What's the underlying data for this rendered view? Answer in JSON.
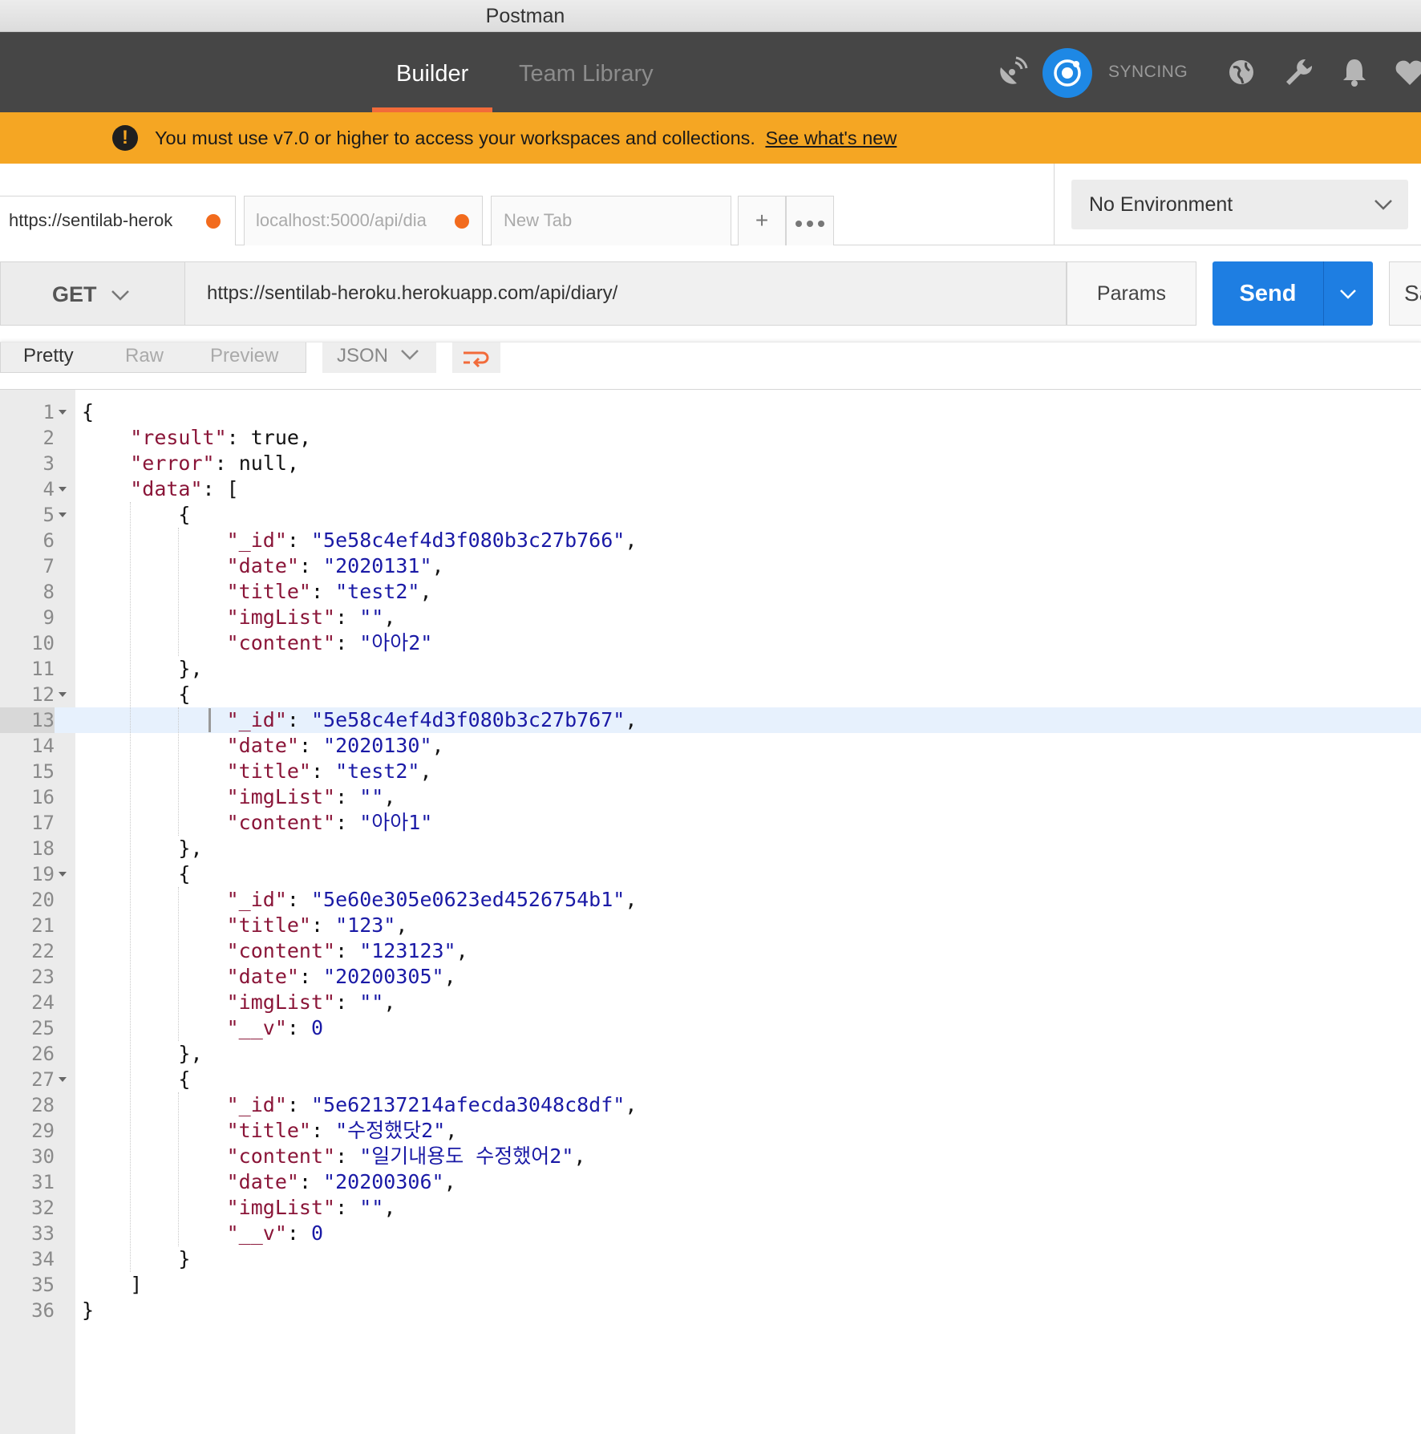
{
  "window": {
    "title": "Postman"
  },
  "nav": {
    "tabs": [
      {
        "label": "Builder"
      },
      {
        "label": "Team Library"
      }
    ],
    "sync_label": "SYNCING",
    "icons": [
      "satellite-icon",
      "sync-icon",
      "globe-icon",
      "wrench-icon",
      "bell-icon",
      "heart-icon"
    ]
  },
  "banner": {
    "message": "You must use v7.0 or higher to access your workspaces and collections.",
    "link": "See what's new",
    "color": "#f5a623"
  },
  "tabs": [
    {
      "label": "https://sentilab-herok",
      "unsaved": true
    },
    {
      "label": "localhost:5000/api/dia",
      "unsaved": true
    },
    {
      "label": "New Tab",
      "unsaved": false
    }
  ],
  "environment": {
    "selected": "No Environment"
  },
  "request": {
    "method": "GET",
    "url": "https://sentilab-heroku.herokuapp.com/api/diary/",
    "params_label": "Params",
    "send_label": "Send",
    "save_label": "Sa",
    "accent": "#1e7ee2"
  },
  "response": {
    "view_tabs": [
      "Pretty",
      "Raw",
      "Preview"
    ],
    "active_view": "Pretty",
    "format": "JSON",
    "highlighted_line": 13,
    "lines": [
      "{",
      "    \"result\": true,",
      "    \"error\": null,",
      "    \"data\": [",
      "        {",
      "            \"_id\": \"5e58c4ef4d3f080b3c27b766\",",
      "            \"date\": \"2020131\",",
      "            \"title\": \"test2\",",
      "            \"imgList\": \"\",",
      "            \"content\": \"아아2\"",
      "        },",
      "        {",
      "            \"_id\": \"5e58c4ef4d3f080b3c27b767\",",
      "            \"date\": \"2020130\",",
      "            \"title\": \"test2\",",
      "            \"imgList\": \"\",",
      "            \"content\": \"아아1\"",
      "        },",
      "        {",
      "            \"_id\": \"5e60e305e0623ed4526754b1\",",
      "            \"title\": \"123\",",
      "            \"content\": \"123123\",",
      "            \"date\": \"20200305\",",
      "            \"imgList\": \"\",",
      "            \"__v\": 0",
      "        },",
      "        {",
      "            \"_id\": \"5e62137214afecda3048c8df\",",
      "            \"title\": \"수정했닷2\",",
      "            \"content\": \"일기내용도 수정했어2\",",
      "            \"date\": \"20200306\",",
      "            \"imgList\": \"\",",
      "            \"__v\": 0",
      "        }",
      "    ]",
      "}"
    ]
  }
}
